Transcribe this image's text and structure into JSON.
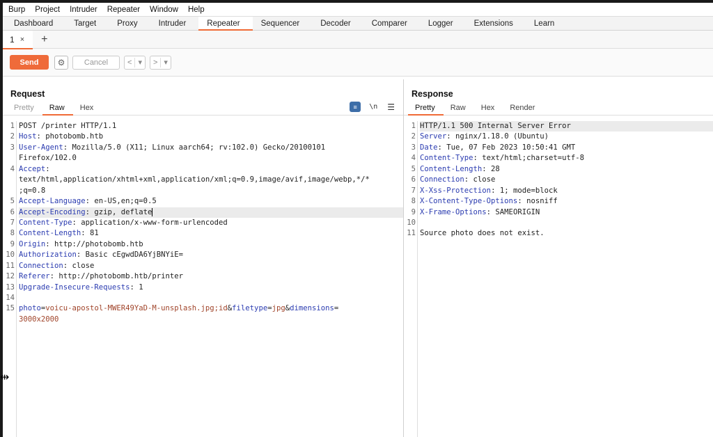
{
  "menu": [
    "Burp",
    "Project",
    "Intruder",
    "Repeater",
    "Window",
    "Help"
  ],
  "main_tabs": [
    "Dashboard",
    "Target",
    "Proxy",
    "Intruder",
    "Repeater",
    "Sequencer",
    "Decoder",
    "Comparer",
    "Logger",
    "Extensions",
    "Learn"
  ],
  "active_main_tab": "Repeater",
  "repeater_tab": {
    "label": "1",
    "close": "×",
    "add": "+"
  },
  "toolbar": {
    "send": "Send",
    "cancel": "Cancel",
    "prev": "<",
    "next": ">",
    "dropdown": "▾"
  },
  "request": {
    "title": "Request",
    "tabs": [
      "Pretty",
      "Raw",
      "Hex"
    ],
    "active_tab": "Raw",
    "tool_newline": "\\n",
    "tool_menu": "☰",
    "line_numbers": [
      "1",
      "2",
      "3",
      "",
      "4",
      "",
      "",
      "5",
      "6",
      "7",
      "8",
      "9",
      "10",
      "11",
      "12",
      "13",
      "14",
      "15",
      ""
    ],
    "lines": [
      {
        "k": "",
        "v": "POST /printer HTTP/1.1"
      },
      {
        "k": "Host",
        "v": ": photobomb.htb"
      },
      {
        "k": "User-Agent",
        "v": ": Mozilla/5.0 (X11; Linux aarch64; rv:102.0) Gecko/20100101"
      },
      {
        "k": "",
        "v": "Firefox/102.0"
      },
      {
        "k": "Accept",
        "v": ":"
      },
      {
        "k": "",
        "v": "text/html,application/xhtml+xml,application/xml;q=0.9,image/avif,image/webp,*/*"
      },
      {
        "k": "",
        "v": ";q=0.8"
      },
      {
        "k": "Accept-Language",
        "v": ": en-US,en;q=0.5"
      },
      {
        "k": "Accept-Encoding",
        "v": ": gzip, deflate"
      },
      {
        "k": "Content-Type",
        "v": ": application/x-www-form-urlencoded"
      },
      {
        "k": "Content-Length",
        "v": ": 81"
      },
      {
        "k": "Origin",
        "v": ": http://photobomb.htb"
      },
      {
        "k": "Authorization",
        "v": ": Basic cEgwdDA6YjBNYiE="
      },
      {
        "k": "Connection",
        "v": ": close"
      },
      {
        "k": "Referer",
        "v": ": http://photobomb.htb/printer"
      },
      {
        "k": "Upgrade-Insecure-Requests",
        "v": ": 1"
      },
      {
        "k": "",
        "v": ""
      }
    ],
    "body_line1": [
      {
        "t": "photo",
        "c": "pk"
      },
      {
        "t": "=",
        "c": ""
      },
      {
        "t": "voicu-apostol-MWER49YaD-M-unsplash.jpg;id",
        "c": "pv"
      },
      {
        "t": "&",
        "c": ""
      },
      {
        "t": "filetype",
        "c": "pk"
      },
      {
        "t": "=",
        "c": ""
      },
      {
        "t": "jpg",
        "c": "pv"
      },
      {
        "t": "&",
        "c": ""
      },
      {
        "t": "dimensions",
        "c": "pk"
      },
      {
        "t": "=",
        "c": ""
      }
    ],
    "body_line2": "3000x2000"
  },
  "response": {
    "title": "Response",
    "tabs": [
      "Pretty",
      "Raw",
      "Hex",
      "Render"
    ],
    "active_tab": "Pretty",
    "line_numbers": [
      "1",
      "2",
      "3",
      "4",
      "5",
      "6",
      "7",
      "8",
      "9",
      "10",
      "11"
    ],
    "lines": [
      {
        "k": "",
        "v": "HTTP/1.1 500 Internal Server Error"
      },
      {
        "k": "Server",
        "v": ": nginx/1.18.0 (Ubuntu)"
      },
      {
        "k": "Date",
        "v": ": Tue, 07 Feb 2023 10:50:41 GMT"
      },
      {
        "k": "Content-Type",
        "v": ": text/html;charset=utf-8"
      },
      {
        "k": "Content-Length",
        "v": ": 28"
      },
      {
        "k": "Connection",
        "v": ": close"
      },
      {
        "k": "X-Xss-Protection",
        "v": ": 1; mode=block"
      },
      {
        "k": "X-Content-Type-Options",
        "v": ": nosniff"
      },
      {
        "k": "X-Frame-Options",
        "v": ": SAMEORIGIN"
      },
      {
        "k": "",
        "v": ""
      },
      {
        "k": "",
        "v": "Source photo does not exist."
      }
    ]
  },
  "colors": {
    "accent": "#f06a35",
    "header_key": "#2a3bb0",
    "param_value": "#a0442a"
  },
  "icons": {
    "settings": "gear-icon",
    "cursor": "resize-cursor-icon"
  }
}
